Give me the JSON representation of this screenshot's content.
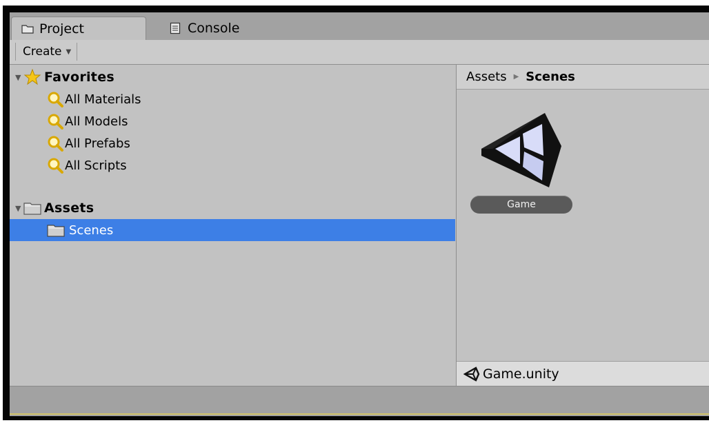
{
  "tabs": [
    {
      "label": "Project",
      "icon": "folder-icon",
      "active": true
    },
    {
      "label": "Console",
      "icon": "console-icon",
      "active": false
    }
  ],
  "toolbar": {
    "create_label": "Create"
  },
  "favorites": {
    "label": "Favorites",
    "items": [
      {
        "label": "All Materials",
        "icon": "search-icon"
      },
      {
        "label": "All Models",
        "icon": "search-icon"
      },
      {
        "label": "All Prefabs",
        "icon": "search-icon"
      },
      {
        "label": "All Scripts",
        "icon": "search-icon"
      }
    ]
  },
  "assets": {
    "label": "Assets",
    "children": [
      {
        "label": "Scenes",
        "icon": "folder-icon",
        "selected": true
      }
    ]
  },
  "breadcrumb": {
    "root": "Assets",
    "current": "Scenes"
  },
  "grid_items": [
    {
      "label": "Game",
      "icon": "unity-logo-icon"
    }
  ],
  "status": {
    "selected_file": "Game.unity"
  },
  "colors": {
    "selection": "#3d7fe6",
    "panel": "#c2c2c2",
    "toolbar": "#cbcbcb"
  }
}
